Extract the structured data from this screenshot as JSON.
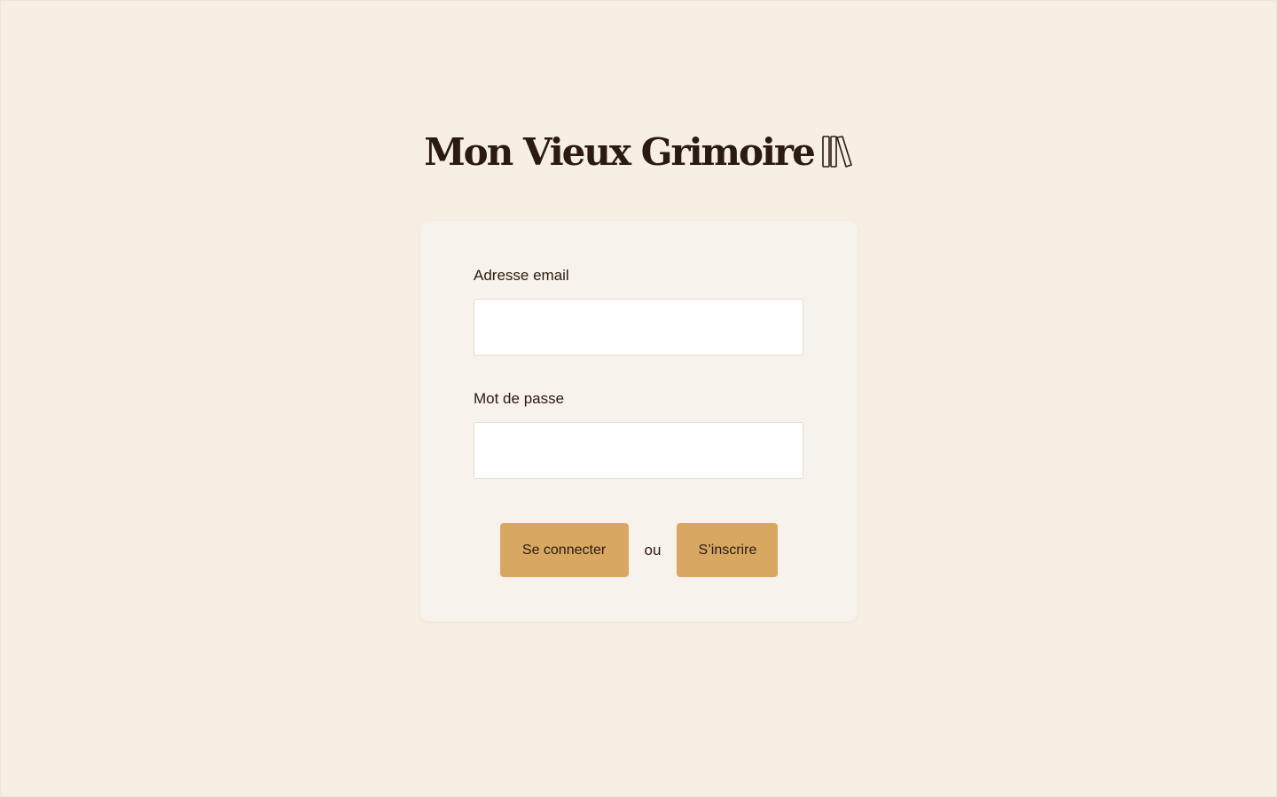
{
  "app": {
    "title": "Mon Vieux Grimoire",
    "logo_icon": "books-icon"
  },
  "login_form": {
    "email_label": "Adresse email",
    "email_value": "",
    "password_label": "Mot de passe",
    "password_value": "",
    "login_button": "Se connecter",
    "separator": "ou",
    "signup_button": "S’inscrire"
  },
  "colors": {
    "background": "#f7efe3",
    "card": "#f7f2eb",
    "accent": "#d8a862",
    "text": "#2a1a12"
  }
}
